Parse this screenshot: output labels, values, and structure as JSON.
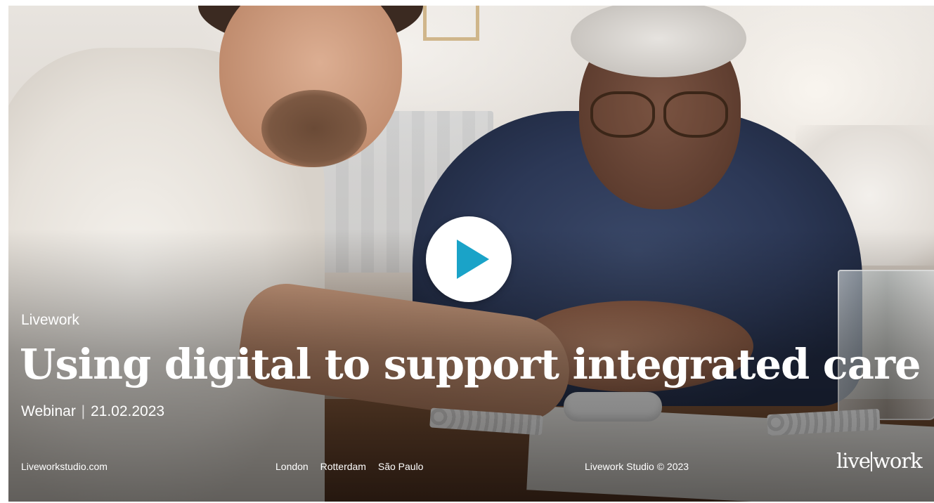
{
  "video": {
    "brand_label": "Livework",
    "title": "Using digital to support integrated care",
    "subtitle_type": "Webinar",
    "subtitle_separator": "|",
    "subtitle_date": "21.02.2023",
    "play_icon": "play-icon",
    "accent_color": "#1aa3c8"
  },
  "footer": {
    "website": "Liveworkstudio.com",
    "cities": [
      "London",
      "Rotterdam",
      "São Paulo"
    ],
    "copyright": "Livework Studio © 2023",
    "logo_left": "live",
    "logo_right": "work"
  }
}
